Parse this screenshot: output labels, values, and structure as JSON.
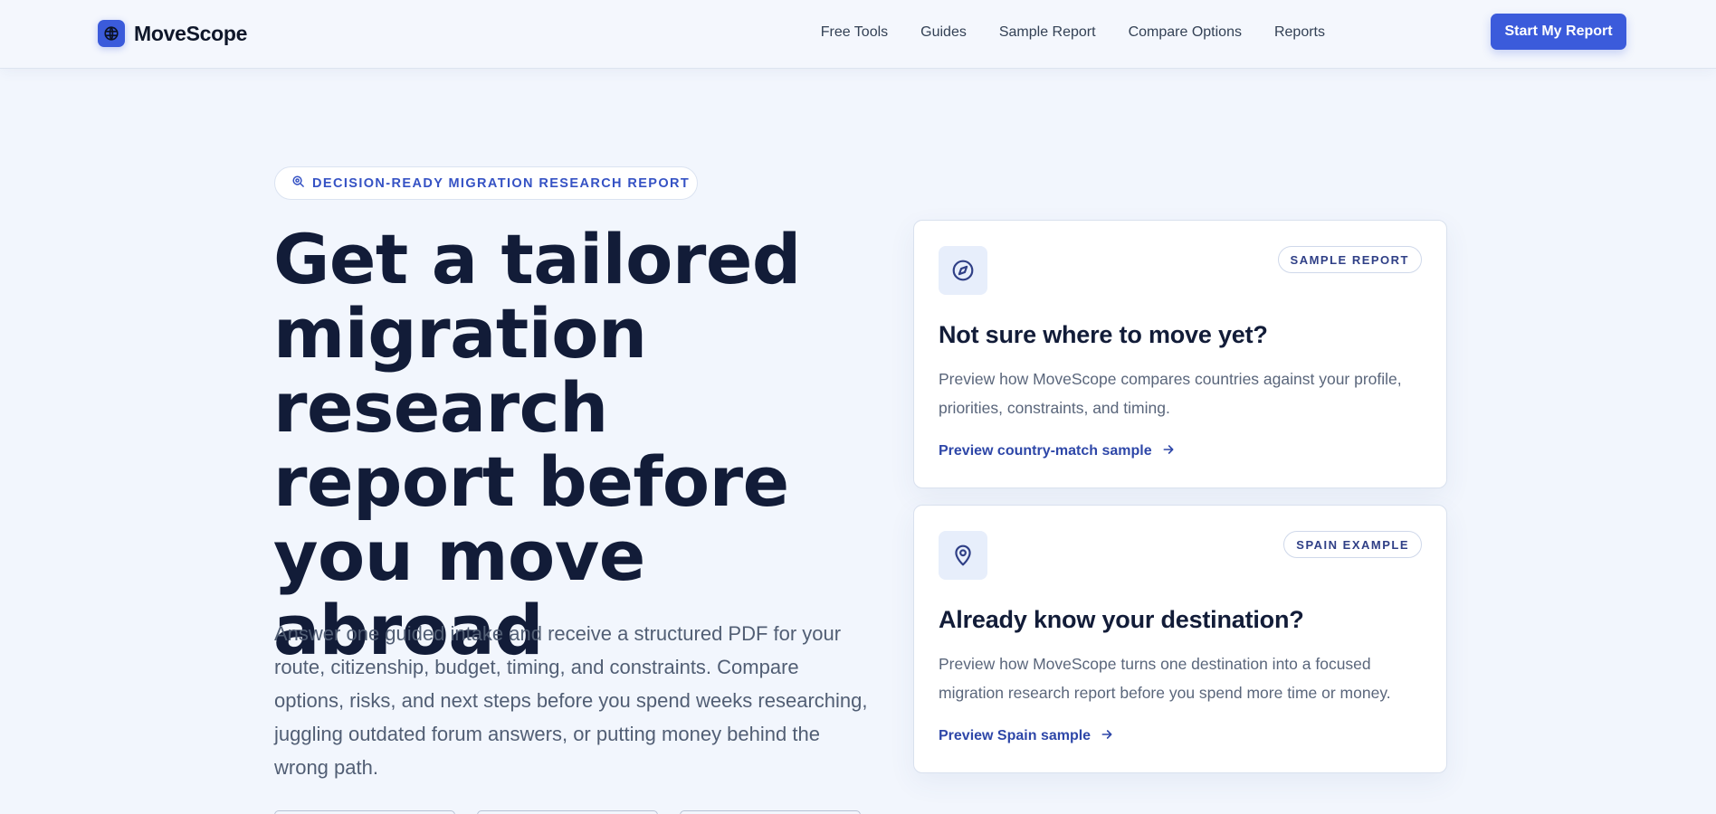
{
  "header": {
    "brand_name": "MoveScope",
    "nav": [
      "Free Tools",
      "Guides",
      "Sample Report",
      "Compare Options",
      "Reports"
    ],
    "cta_label": "Start My Report"
  },
  "hero": {
    "eyebrow": "DECISION-READY MIGRATION RESEARCH REPORT",
    "title": "Get a tailored migration research report before you move abroad",
    "subtitle": "Answer one guided intake and receive a structured PDF for your route, citizenship, budget, timing, and constraints. Compare options, risks, and next steps before you spend weeks researching, juggling outdated forum answers, or putting money behind the wrong path."
  },
  "cards": [
    {
      "icon": "compass-icon",
      "badge": "SAMPLE REPORT",
      "title": "Not sure where to move yet?",
      "description": "Preview how MoveScope compares countries against your profile, priorities, constraints, and timing.",
      "link": "Preview country-match sample"
    },
    {
      "icon": "map-pin-icon",
      "badge": "SPAIN EXAMPLE",
      "title": "Already know your destination?",
      "description": "Preview how MoveScope turns one destination into a focused migration research report before you spend more time or money.",
      "link": "Preview Spain sample"
    }
  ],
  "colors": {
    "accent": "#3b5bdb",
    "background": "#f2f6fd",
    "heading": "#121c38",
    "body_text": "#515e74",
    "link": "#2e47a8"
  }
}
